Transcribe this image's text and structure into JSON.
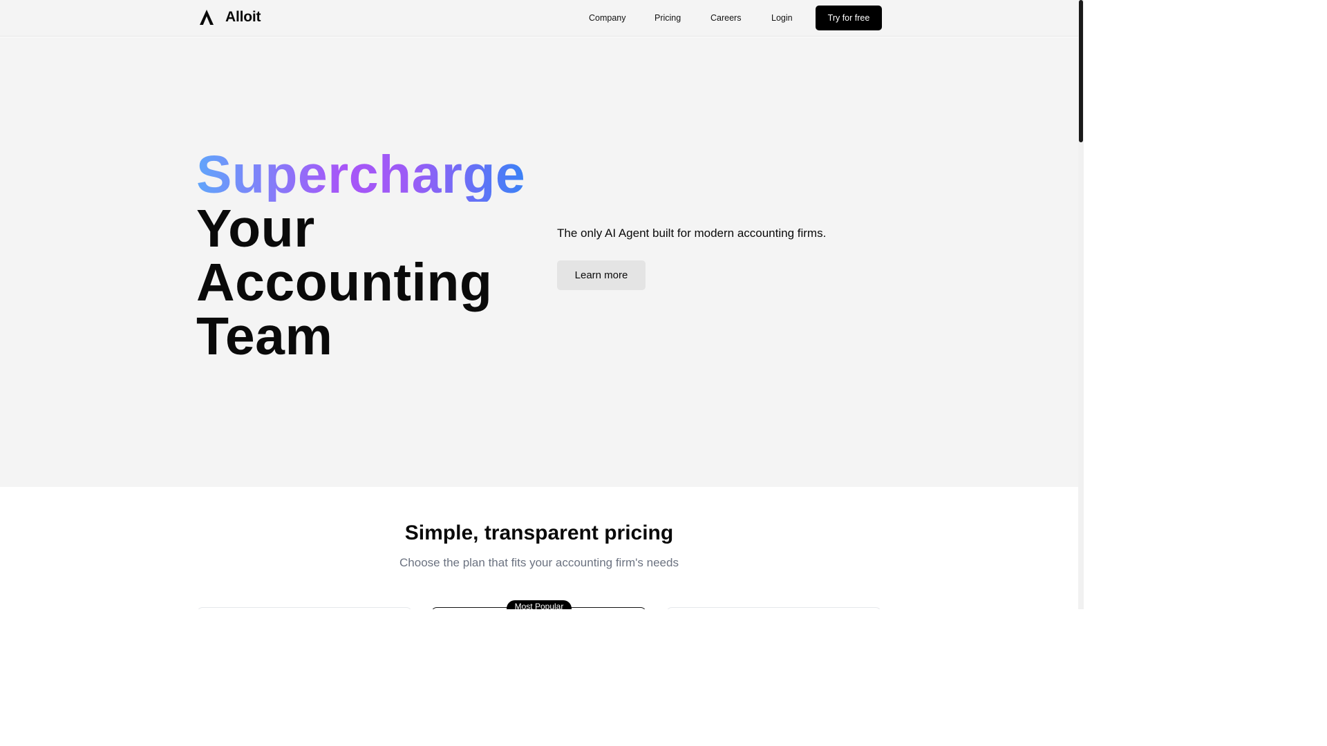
{
  "brand": {
    "name": "Alloit",
    "logo_icon": "triangle-logo-icon"
  },
  "nav": {
    "items": [
      {
        "label": "Company"
      },
      {
        "label": "Pricing"
      },
      {
        "label": "Careers"
      },
      {
        "label": "Login"
      }
    ],
    "cta_label": "Try for free"
  },
  "hero": {
    "headline_gradient": "Supercharge",
    "headline_lines": [
      "Your",
      "Accounting",
      "Team"
    ],
    "tagline": "The only AI Agent built for modern accounting firms.",
    "button_label": "Learn more",
    "gradient_colors": [
      "#60a5fa",
      "#a855f7",
      "#3b82f6"
    ]
  },
  "pricing": {
    "title": "Simple, transparent pricing",
    "subtitle": "Choose the plan that fits your accounting firm's needs",
    "popular_badge": "Most Popular"
  },
  "colors": {
    "hero_bg": "#f4f4f4",
    "cta_bg": "#000000",
    "secondary_button_bg": "#e4e4e4",
    "muted_text": "#6b7280"
  }
}
